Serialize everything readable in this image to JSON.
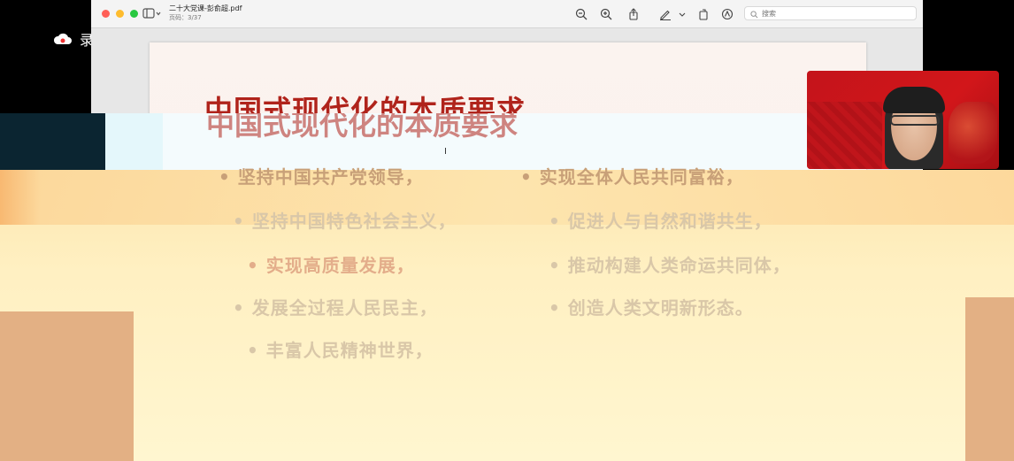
{
  "recording": {
    "label": "录制中",
    "icon": "cloud-icon"
  },
  "window": {
    "title": "二十大党课-彭俞超.pdf",
    "subtitle": "页码：3/37",
    "search_placeholder": "搜索",
    "toolbar": [
      "zoom-out-icon",
      "zoom-in-icon",
      "share-icon",
      "markup-pen-icon",
      "rotate-icon",
      "annotate-icon"
    ]
  },
  "slide": {
    "title": "中国式现代化的本质要求",
    "left_bullets": [
      "• 坚持中国共产党领导，",
      "• 坚持中国特色社会主义，",
      "• 实现高质量发展，",
      "• 发展全过程人民民主，",
      "• 丰富人民精神世界，"
    ],
    "right_bullets": [
      "• 实现全体人民共同富裕，",
      "• 促进人与自然和谐共生，",
      "• 推动构建人类命运共同体，",
      "• 创造人类文明新形态。"
    ]
  },
  "colors": {
    "title_red": "#b0231b",
    "band_yellow": "#fde7b0",
    "side_tan": "#e3b084"
  }
}
